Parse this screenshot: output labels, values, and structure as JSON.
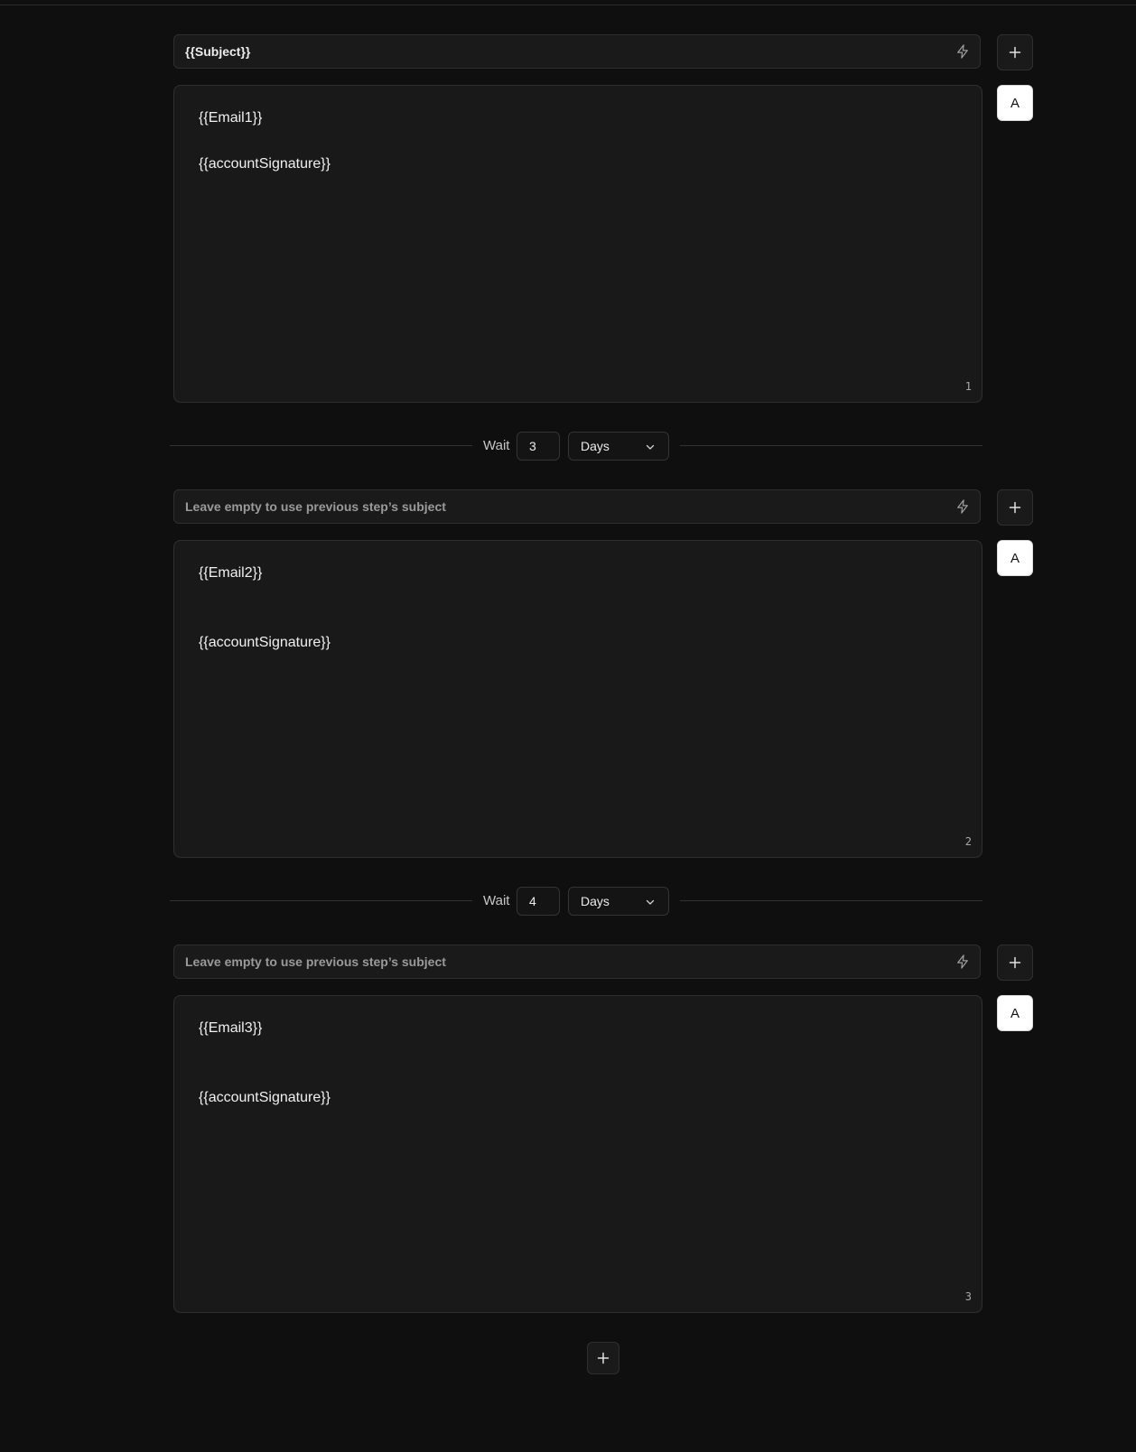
{
  "steps": [
    {
      "subject_value": "{{Subject}}",
      "subject_placeholder": "",
      "body_lines": [
        "{{Email1}}",
        "{{accountSignature}}"
      ],
      "number": "1",
      "font_button_label": "A"
    },
    {
      "subject_value": "",
      "subject_placeholder": "Leave empty to use previous step’s subject",
      "body_lines": [
        "{{Email2}}",
        "{{accountSignature}}"
      ],
      "number": "2",
      "font_button_label": "A"
    },
    {
      "subject_value": "",
      "subject_placeholder": "Leave empty to use previous step’s subject",
      "body_lines": [
        "{{Email3}}",
        "{{accountSignature}}"
      ],
      "number": "3",
      "font_button_label": "A"
    }
  ],
  "waits": [
    {
      "label": "Wait",
      "value": "3",
      "unit": "Days"
    },
    {
      "label": "Wait",
      "value": "4",
      "unit": "Days"
    }
  ],
  "icons": {
    "subject_action": "bolt-icon",
    "add_variable": "plus-icon",
    "unit_dropdown": "chevron-down-icon",
    "add_step": "plus-icon"
  },
  "colors": {
    "background": "#0f0f10",
    "field": "#1a1a1b",
    "border": "#2f2f31",
    "text": "#ececec",
    "placeholder": "#9a9a9c"
  }
}
